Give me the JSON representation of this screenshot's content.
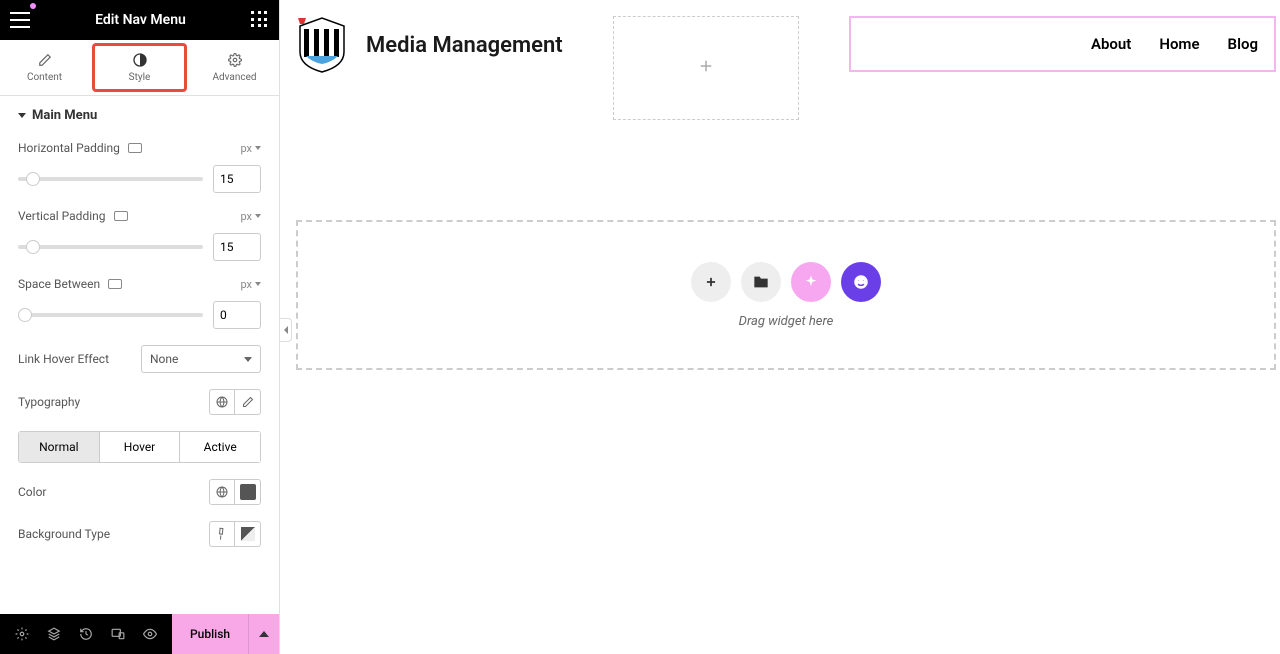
{
  "header": {
    "title": "Edit Nav Menu"
  },
  "tabs": {
    "content": "Content",
    "style": "Style",
    "advanced": "Advanced"
  },
  "section": {
    "title": "Main Menu"
  },
  "controls": {
    "horizontal_padding_label": "Horizontal Padding",
    "horizontal_padding_value": "15",
    "horizontal_padding_unit": "px",
    "vertical_padding_label": "Vertical Padding",
    "vertical_padding_value": "15",
    "vertical_padding_unit": "px",
    "space_between_label": "Space Between",
    "space_between_value": "0",
    "space_between_unit": "px",
    "link_hover_label": "Link Hover Effect",
    "link_hover_value": "None",
    "typography_label": "Typography",
    "color_label": "Color",
    "bg_type_label": "Background Type"
  },
  "state_tabs": {
    "normal": "Normal",
    "hover": "Hover",
    "active": "Active"
  },
  "bottombar": {
    "publish": "Publish"
  },
  "canvas": {
    "site_title": "Media Management",
    "nav_items": {
      "about": "About",
      "home": "Home",
      "blog": "Blog"
    },
    "drop_text": "Drag widget here"
  }
}
